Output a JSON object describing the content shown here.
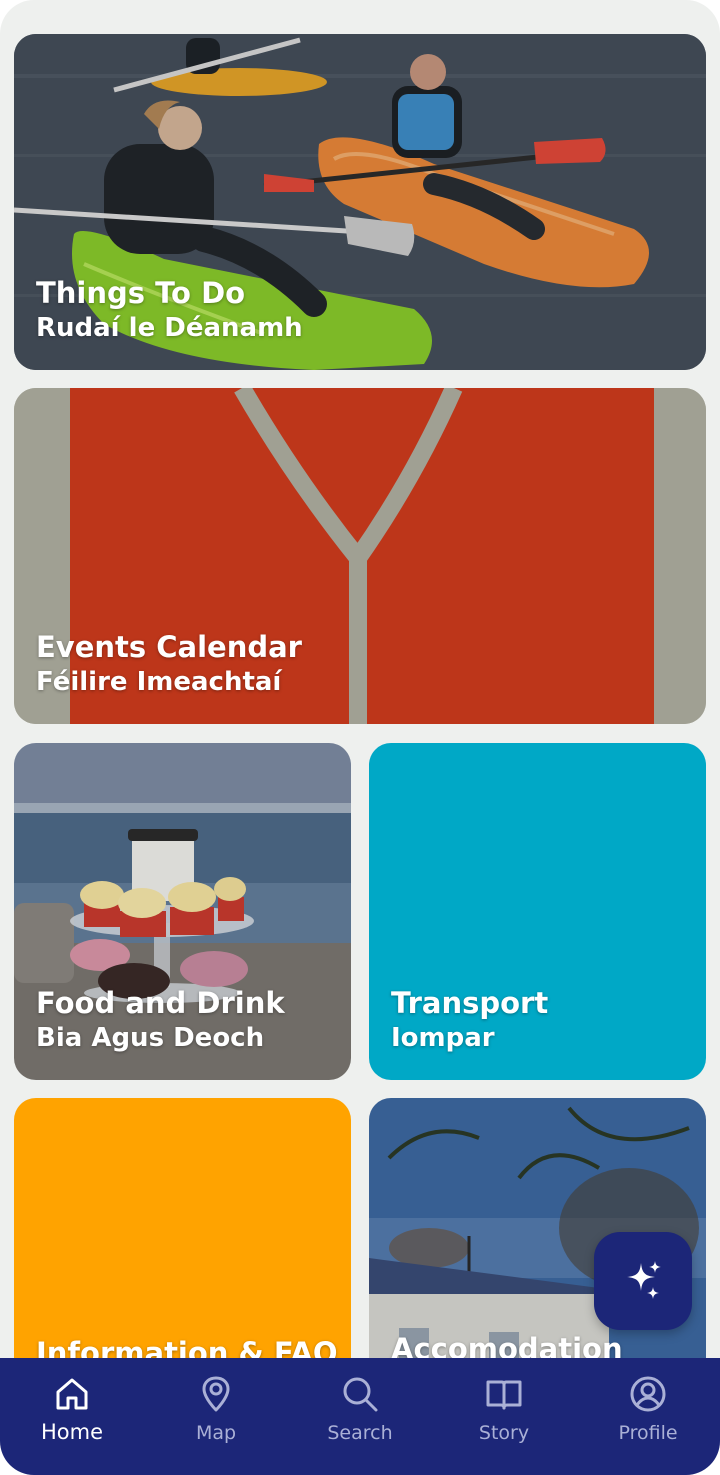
{
  "tiles": {
    "things_to_do": {
      "title": "Things To Do",
      "subtitle": "Rudaí le Déanamh"
    },
    "events": {
      "title": "Events Calendar",
      "subtitle": "Féilire Imeachtaí"
    },
    "food": {
      "title": "Food and Drink",
      "subtitle": "Bia Agus Deoch"
    },
    "transport": {
      "title": "Transport",
      "subtitle": "Iompar"
    },
    "info": {
      "title": "Information & FAQ"
    },
    "accommodation": {
      "title": "Accomodation"
    }
  },
  "nav": {
    "home": "Home",
    "map": "Map",
    "search": "Search",
    "story": "Story",
    "profile": "Profile",
    "active": "home"
  },
  "colors": {
    "nav_bg": "#1c2678",
    "transport": "#00a8c6",
    "info": "#ffa300",
    "events_red": "#c8391c"
  },
  "icons": {
    "fab": "sparkles-icon",
    "home": "home-icon",
    "map": "map-pin-icon",
    "search": "search-icon",
    "story": "book-icon",
    "profile": "user-circle-icon"
  }
}
